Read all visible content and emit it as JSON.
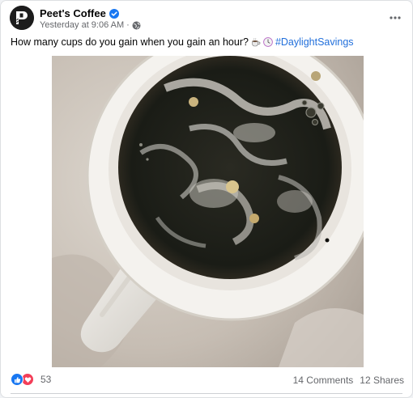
{
  "post": {
    "page_name": "Peet's Coffee",
    "timestamp": "Yesterday at 9:06 AM",
    "separator": "·",
    "caption_text": "How many cups do you gain when you gain an hour?",
    "hashtag": "#DaylightSavings",
    "icons": {
      "verified": "verified-badge-icon",
      "audience": "globe-icon",
      "more": "more-options-icon",
      "emoji_1": "hot-beverage-emoji",
      "emoji_2": "clock-emoji"
    }
  },
  "footer": {
    "reaction_count": "53",
    "comments": "14 Comments",
    "shares": "12 Shares",
    "reaction_icons": [
      "like-icon",
      "love-icon"
    ]
  },
  "colors": {
    "link": "#216fdb",
    "like": "#1877f2",
    "love": "#f33e58",
    "muted": "#65676b"
  }
}
